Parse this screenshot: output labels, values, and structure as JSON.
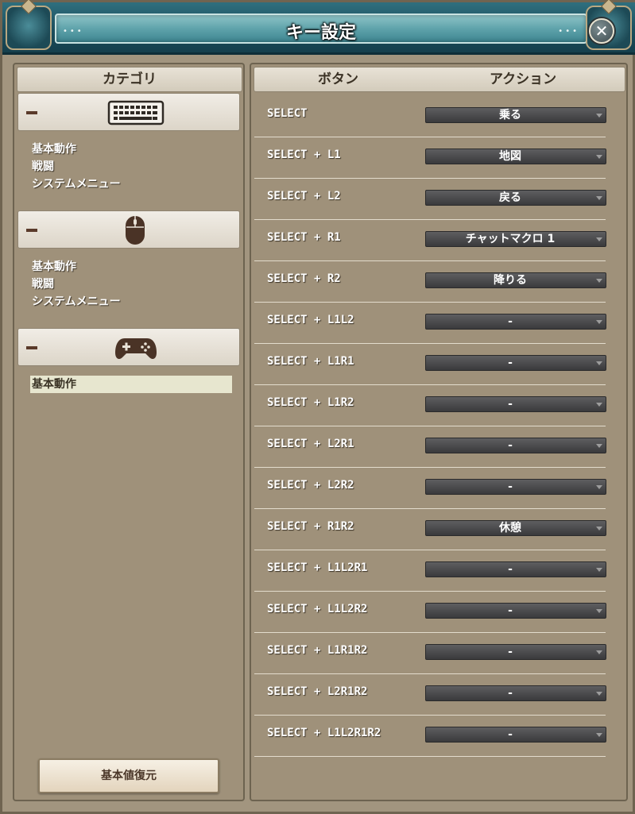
{
  "window": {
    "title": "キー設定"
  },
  "category": {
    "header": "カテゴリ",
    "groups": [
      {
        "icon": "keyboard-icon",
        "items": [
          "基本動作",
          "戦闘",
          "システムメニュー"
        ]
      },
      {
        "icon": "mouse-icon",
        "items": [
          "基本動作",
          "戦闘",
          "システムメニュー"
        ]
      },
      {
        "icon": "gamepad-icon",
        "items": [
          "基本動作"
        ],
        "selected": "基本動作"
      }
    ],
    "restore_label": "基本値復元"
  },
  "bindings": {
    "col_button": "ボタン",
    "col_action": "アクション",
    "rows": [
      {
        "button": "SELECT",
        "action": "乗る"
      },
      {
        "button": "SELECT + L1",
        "action": "地図"
      },
      {
        "button": "SELECT + L2",
        "action": "戻る"
      },
      {
        "button": "SELECT + R1",
        "action": "チャットマクロ 1"
      },
      {
        "button": "SELECT + R2",
        "action": "降りる"
      },
      {
        "button": "SELECT + L1L2",
        "action": "-"
      },
      {
        "button": "SELECT + L1R1",
        "action": "-"
      },
      {
        "button": "SELECT + L1R2",
        "action": "-"
      },
      {
        "button": "SELECT + L2R1",
        "action": "-"
      },
      {
        "button": "SELECT + L2R2",
        "action": "-"
      },
      {
        "button": "SELECT + R1R2",
        "action": "休憩"
      },
      {
        "button": "SELECT + L1L2R1",
        "action": "-"
      },
      {
        "button": "SELECT + L1L2R2",
        "action": "-"
      },
      {
        "button": "SELECT + L1R1R2",
        "action": "-"
      },
      {
        "button": "SELECT + L2R1R2",
        "action": "-"
      },
      {
        "button": "SELECT + L1L2R1R2",
        "action": "-"
      }
    ]
  },
  "colors": {
    "panel": "#a2957f",
    "title_bar": "#1c4f5e",
    "select_bg": "#3a3a3c"
  }
}
